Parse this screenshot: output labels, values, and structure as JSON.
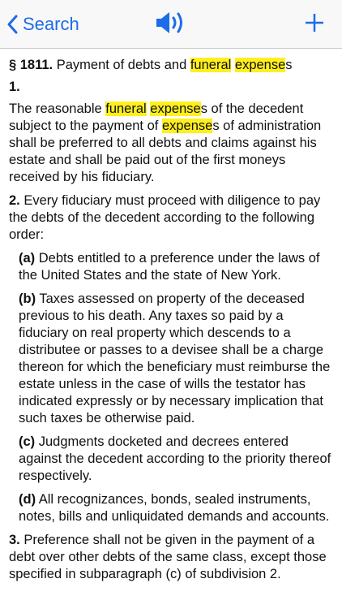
{
  "colors": {
    "accent": "#1d6ce8",
    "highlight": "#ffef1f",
    "navbar_bg": "#f8f8f8",
    "text": "#111111"
  },
  "navbar": {
    "back_label": "Search",
    "back_icon": "chevron-left-icon",
    "speaker_icon": "speaker-icon",
    "add_icon": "plus-icon"
  },
  "section": {
    "sign": "§ 1811.",
    "title_prefix": " Payment of debts and ",
    "title_hl1": "funeral",
    "title_sp": " ",
    "title_hl2": "expense",
    "title_suffix": "s",
    "p1_num": "1.",
    "p1a": "The reasonable ",
    "p1_hl1": "funeral",
    "p1_sp": " ",
    "p1_hl2": "expense",
    "p1b": "s of the decedent subject to the payment of ",
    "p1_hl3": "expense",
    "p1c": "s of administration shall be preferred to all debts and claims against his estate and shall be paid out of the first moneys received by his fiduciary.",
    "p2_num": "2.",
    "p2_text": " Every fiduciary must proceed with diligence to pay the debts of the decedent according to the following order:",
    "a_label": "(a)",
    "a_text": " Debts entitled to a preference under the laws of the United States and the state of New York.",
    "b_label": "(b)",
    "b_text": " Taxes assessed on property of the deceased previous to his death. Any taxes so paid by a fiduciary on real property which descends to a distributee or passes to a devisee shall be a charge thereon for which the beneficiary must reimburse the estate unless in the case of wills the testator has indicated expressly or by necessary implication that such taxes be otherwise paid.",
    "c_label": "(c)",
    "c_text": " Judgments docketed and decrees entered against the decedent according to the priority thereof respectively.",
    "d_label": "(d)",
    "d_text": " All recognizances, bonds, sealed instruments, notes, bills and unliquidated demands and accounts.",
    "p3_num": "3.",
    "p3_text": " Preference shall not be given in the payment of a debt over other debts of the same class, except those specified in subparagraph (c) of subdivision 2."
  }
}
